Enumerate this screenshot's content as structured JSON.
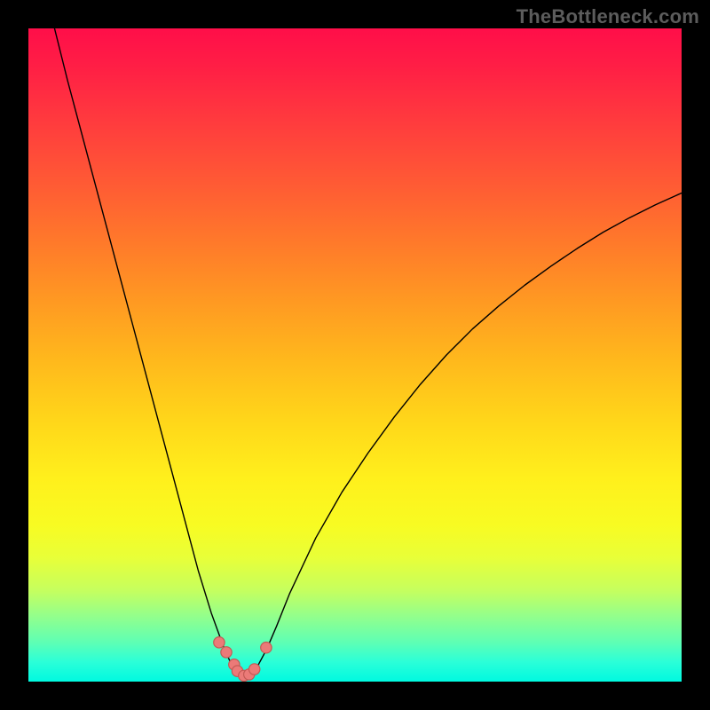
{
  "watermark": "TheBottleneck.com",
  "colors": {
    "curve": "#000000",
    "dot_fill": "#eb7a78",
    "dot_stroke": "#c35a55",
    "gradient_top": "#ff0e49",
    "gradient_bottom": "#00f9e0",
    "background": "#000000"
  },
  "chart_data": {
    "type": "line",
    "title": "",
    "xlabel": "",
    "ylabel": "",
    "x_range": [
      0,
      100
    ],
    "y_range": [
      0,
      100
    ],
    "notes": "Bottleneck-style V-curve. x is a normalized hardware-balance ratio (0–100); y is bottleneck percentage (0 = no bottleneck, 100 = full bottleneck). Curve minimum sits near x ≈ 33.",
    "series": [
      {
        "name": "bottleneck_curve",
        "x": [
          4,
          6,
          8,
          10,
          12,
          14,
          16,
          18,
          20,
          22,
          24,
          26,
          28,
          30,
          31,
          32,
          33,
          34,
          35,
          36.5,
          38,
          40,
          44,
          48,
          52,
          56,
          60,
          64,
          68,
          72,
          76,
          80,
          84,
          88,
          92,
          96,
          100
        ],
        "y": [
          100,
          92,
          84.5,
          77,
          69.5,
          62,
          54.5,
          47,
          39.5,
          32,
          24.5,
          17,
          10.5,
          5,
          2.8,
          1.4,
          0.6,
          1.0,
          2.2,
          5,
          8.5,
          13.5,
          22,
          29,
          35,
          40.5,
          45.5,
          50,
          54,
          57.5,
          60.7,
          63.6,
          66.3,
          68.8,
          71,
          73,
          74.8
        ]
      }
    ],
    "points": [
      {
        "x": 29.2,
        "y": 6.0
      },
      {
        "x": 30.3,
        "y": 4.5
      },
      {
        "x": 31.5,
        "y": 2.6
      },
      {
        "x": 32.0,
        "y": 1.6
      },
      {
        "x": 33.0,
        "y": 0.9
      },
      {
        "x": 33.8,
        "y": 1.1
      },
      {
        "x": 34.6,
        "y": 1.9
      },
      {
        "x": 36.4,
        "y": 5.2
      }
    ]
  }
}
